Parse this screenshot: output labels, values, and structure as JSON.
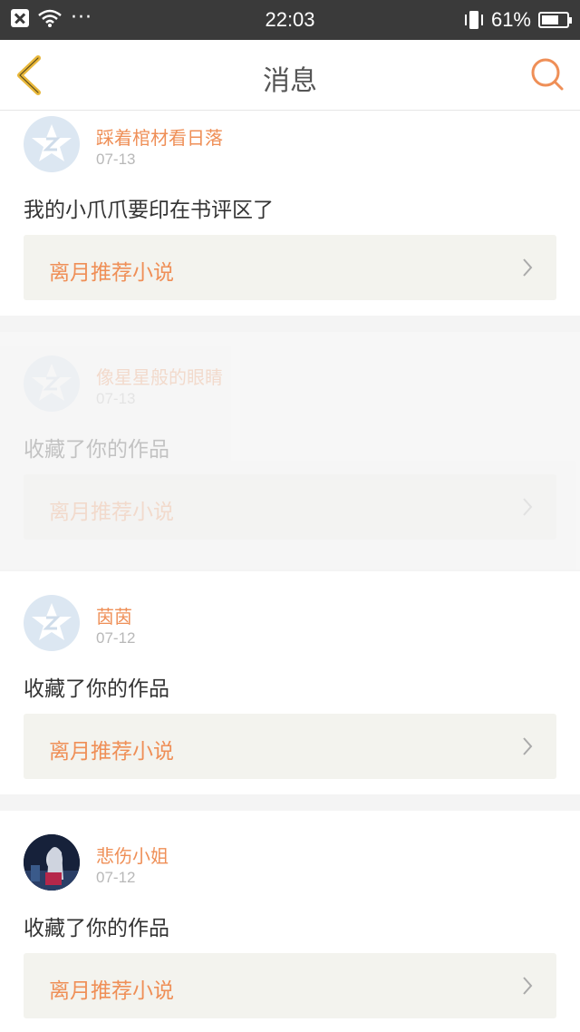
{
  "status_bar": {
    "time": "22:03",
    "battery": "61%",
    "dots": "···"
  },
  "nav": {
    "title": "消息"
  },
  "messages": [
    {
      "user": "踩着棺材看日落",
      "date": "07-13",
      "text": "我的小爪爪要印在书评区了",
      "link": "离月推荐小说",
      "avatar": "default-avatar"
    },
    {
      "user": "像星星般的眼睛",
      "date": "07-13",
      "text": "收藏了你的作品",
      "link": "离月推荐小说",
      "avatar": "default-avatar"
    },
    {
      "user": "茵茵",
      "date": "07-12",
      "text": "收藏了你的作品",
      "link": "离月推荐小说",
      "avatar": "default-avatar"
    },
    {
      "user": "悲伤小姐",
      "date": "07-12",
      "text": "收藏了你的作品",
      "link": "离月推荐小说",
      "avatar": "photo-avatar"
    }
  ],
  "colors": {
    "accent": "#ef8f57",
    "back_icon": "#e8b73a",
    "status_bar": "#3a3a3a"
  }
}
